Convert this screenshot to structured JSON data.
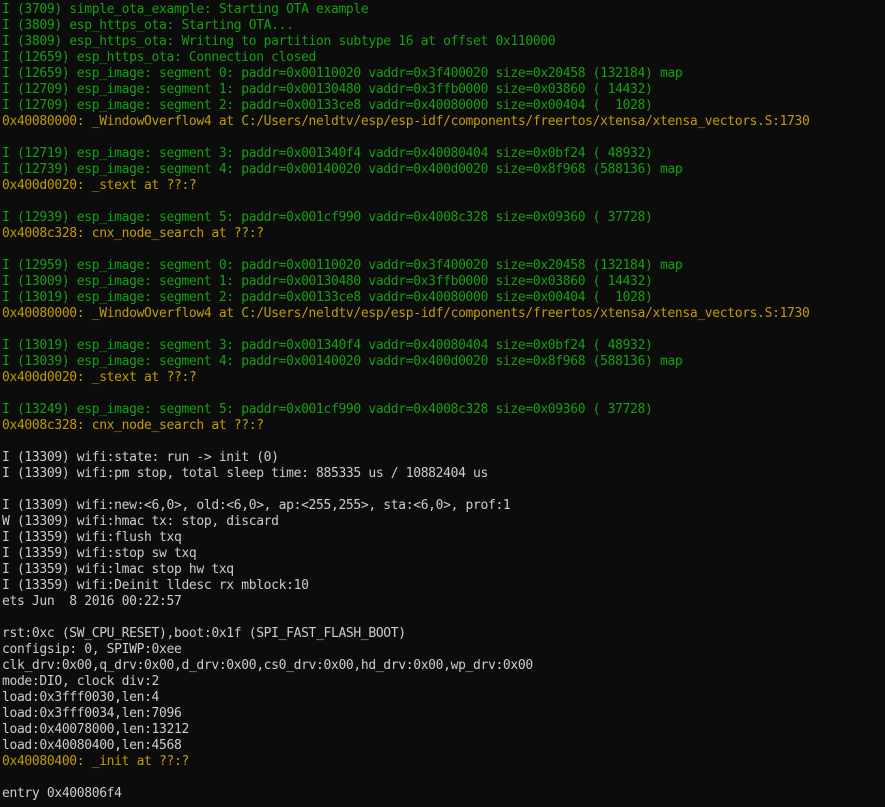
{
  "theme": {
    "background": "#0c0c0c",
    "green": "#13a10e",
    "yellow": "#c19c00",
    "white": "#cccccc"
  },
  "lines": [
    {
      "c": "green",
      "t": "I (3709) simple_ota_example: Starting OTA example"
    },
    {
      "c": "green",
      "t": "I (3809) esp_https_ota: Starting OTA..."
    },
    {
      "c": "green",
      "t": "I (3809) esp_https_ota: Writing to partition subtype 16 at offset 0x110000"
    },
    {
      "c": "green",
      "t": "I (12659) esp_https_ota: Connection closed"
    },
    {
      "c": "green",
      "t": "I (12659) esp_image: segment 0: paddr=0x00110020 vaddr=0x3f400020 size=0x20458 (132184) map"
    },
    {
      "c": "green",
      "t": "I (12709) esp_image: segment 1: paddr=0x00130480 vaddr=0x3ffb0000 size=0x03860 ( 14432)"
    },
    {
      "c": "green",
      "t": "I (12709) esp_image: segment 2: paddr=0x00133ce8 vaddr=0x40080000 size=0x00404 (  1028)"
    },
    {
      "c": "yellow",
      "t": "0x40080000: _WindowOverflow4 at C:/Users/neldtv/esp/esp-idf/components/freertos/xtensa/xtensa_vectors.S:1730"
    },
    {
      "c": "blank",
      "t": ""
    },
    {
      "c": "green",
      "t": "I (12719) esp_image: segment 3: paddr=0x001340f4 vaddr=0x40080404 size=0x0bf24 ( 48932)"
    },
    {
      "c": "green",
      "t": "I (12739) esp_image: segment 4: paddr=0x00140020 vaddr=0x400d0020 size=0x8f968 (588136) map"
    },
    {
      "c": "yellow",
      "t": "0x400d0020: _stext at ??:?"
    },
    {
      "c": "blank",
      "t": ""
    },
    {
      "c": "green",
      "t": "I (12939) esp_image: segment 5: paddr=0x001cf990 vaddr=0x4008c328 size=0x09360 ( 37728)"
    },
    {
      "c": "yellow",
      "t": "0x4008c328: cnx_node_search at ??:?"
    },
    {
      "c": "blank",
      "t": ""
    },
    {
      "c": "green",
      "t": "I (12959) esp_image: segment 0: paddr=0x00110020 vaddr=0x3f400020 size=0x20458 (132184) map"
    },
    {
      "c": "green",
      "t": "I (13009) esp_image: segment 1: paddr=0x00130480 vaddr=0x3ffb0000 size=0x03860 ( 14432)"
    },
    {
      "c": "green",
      "t": "I (13019) esp_image: segment 2: paddr=0x00133ce8 vaddr=0x40080000 size=0x00404 (  1028)"
    },
    {
      "c": "yellow",
      "t": "0x40080000: _WindowOverflow4 at C:/Users/neldtv/esp/esp-idf/components/freertos/xtensa/xtensa_vectors.S:1730"
    },
    {
      "c": "blank",
      "t": ""
    },
    {
      "c": "green",
      "t": "I (13019) esp_image: segment 3: paddr=0x001340f4 vaddr=0x40080404 size=0x0bf24 ( 48932)"
    },
    {
      "c": "green",
      "t": "I (13039) esp_image: segment 4: paddr=0x00140020 vaddr=0x400d0020 size=0x8f968 (588136) map"
    },
    {
      "c": "yellow",
      "t": "0x400d0020: _stext at ??:?"
    },
    {
      "c": "blank",
      "t": ""
    },
    {
      "c": "green",
      "t": "I (13249) esp_image: segment 5: paddr=0x001cf990 vaddr=0x4008c328 size=0x09360 ( 37728)"
    },
    {
      "c": "yellow",
      "t": "0x4008c328: cnx_node_search at ??:?"
    },
    {
      "c": "blank",
      "t": ""
    },
    {
      "c": "white",
      "t": "I (13309) wifi:state: run -> init (0)"
    },
    {
      "c": "white",
      "t": "I (13309) wifi:pm stop, total sleep time: 885335 us / 10882404 us"
    },
    {
      "c": "blank",
      "t": ""
    },
    {
      "c": "white",
      "t": "I (13309) wifi:new:<6,0>, old:<6,0>, ap:<255,255>, sta:<6,0>, prof:1"
    },
    {
      "c": "white",
      "t": "W (13309) wifi:hmac tx: stop, discard"
    },
    {
      "c": "white",
      "t": "I (13359) wifi:flush txq"
    },
    {
      "c": "white",
      "t": "I (13359) wifi:stop sw txq"
    },
    {
      "c": "white",
      "t": "I (13359) wifi:lmac stop hw txq"
    },
    {
      "c": "white",
      "t": "I (13359) wifi:Deinit lldesc rx mblock:10"
    },
    {
      "c": "white",
      "t": "ets Jun  8 2016 00:22:57"
    },
    {
      "c": "blank",
      "t": ""
    },
    {
      "c": "white",
      "t": "rst:0xc (SW_CPU_RESET),boot:0x1f (SPI_FAST_FLASH_BOOT)"
    },
    {
      "c": "white",
      "t": "configsip: 0, SPIWP:0xee"
    },
    {
      "c": "white",
      "t": "clk_drv:0x00,q_drv:0x00,d_drv:0x00,cs0_drv:0x00,hd_drv:0x00,wp_drv:0x00"
    },
    {
      "c": "white",
      "t": "mode:DIO, clock div:2"
    },
    {
      "c": "white",
      "t": "load:0x3fff0030,len:4"
    },
    {
      "c": "white",
      "t": "load:0x3fff0034,len:7096"
    },
    {
      "c": "white",
      "t": "load:0x40078000,len:13212"
    },
    {
      "c": "white",
      "t": "load:0x40080400,len:4568"
    },
    {
      "c": "yellow",
      "t": "0x40080400: _init at ??:?"
    },
    {
      "c": "blank",
      "t": ""
    },
    {
      "c": "white",
      "t": "entry 0x400806f4"
    }
  ]
}
